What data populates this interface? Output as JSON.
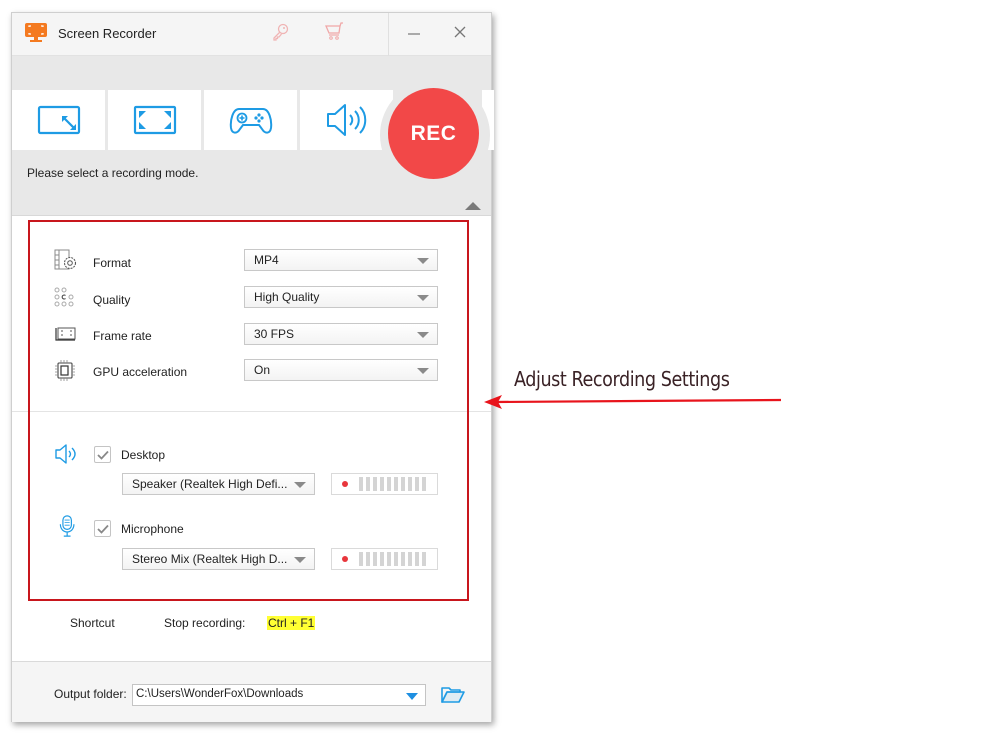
{
  "window": {
    "title": "Screen Recorder",
    "icons": {
      "logo": "screen-recorder-logo-icon",
      "register": "key-icon",
      "buy": "cart-icon",
      "minimize": "minimize-icon",
      "close": "close-icon"
    }
  },
  "modes": {
    "items": [
      {
        "name": "region-mode",
        "icon": "region-resize-icon"
      },
      {
        "name": "fullscreen-mode",
        "icon": "fullscreen-icon"
      },
      {
        "name": "game-mode",
        "icon": "gamepad-icon"
      },
      {
        "name": "audio-only-mode",
        "icon": "speaker-icon"
      }
    ],
    "rec_label": "REC",
    "hint": "Please select a recording mode."
  },
  "settings": {
    "rows": [
      {
        "label": "Format",
        "value": "MP4",
        "icon": "format-gear-icon"
      },
      {
        "label": "Quality",
        "value": "High Quality",
        "icon": "quality-dots-icon"
      },
      {
        "label": "Frame rate",
        "value": "30 FPS",
        "icon": "frame-rate-icon"
      },
      {
        "label": "GPU acceleration",
        "value": "On",
        "icon": "gpu-chip-icon"
      }
    ]
  },
  "audio": {
    "desktop": {
      "label": "Desktop",
      "checked": true,
      "device": "Speaker (Realtek High Defi...",
      "level_bars": 10,
      "level_active": 0
    },
    "microphone": {
      "label": "Microphone",
      "checked": true,
      "device": "Stereo Mix (Realtek High D...",
      "level_bars": 10,
      "level_active": 0
    }
  },
  "shortcut": {
    "label": "Shortcut",
    "action": "Stop recording:",
    "keys": "Ctrl + F1"
  },
  "output": {
    "label": "Output folder:",
    "path": "C:\\Users\\WonderFox\\Downloads"
  },
  "annotation": {
    "text": "Adjust Recording Settings",
    "color": "#e8141c"
  },
  "colors": {
    "accent_blue": "#1e9be4",
    "rec_red": "#f24848",
    "highlight_red": "#c8161d",
    "logo_orange": "#f47a20"
  }
}
